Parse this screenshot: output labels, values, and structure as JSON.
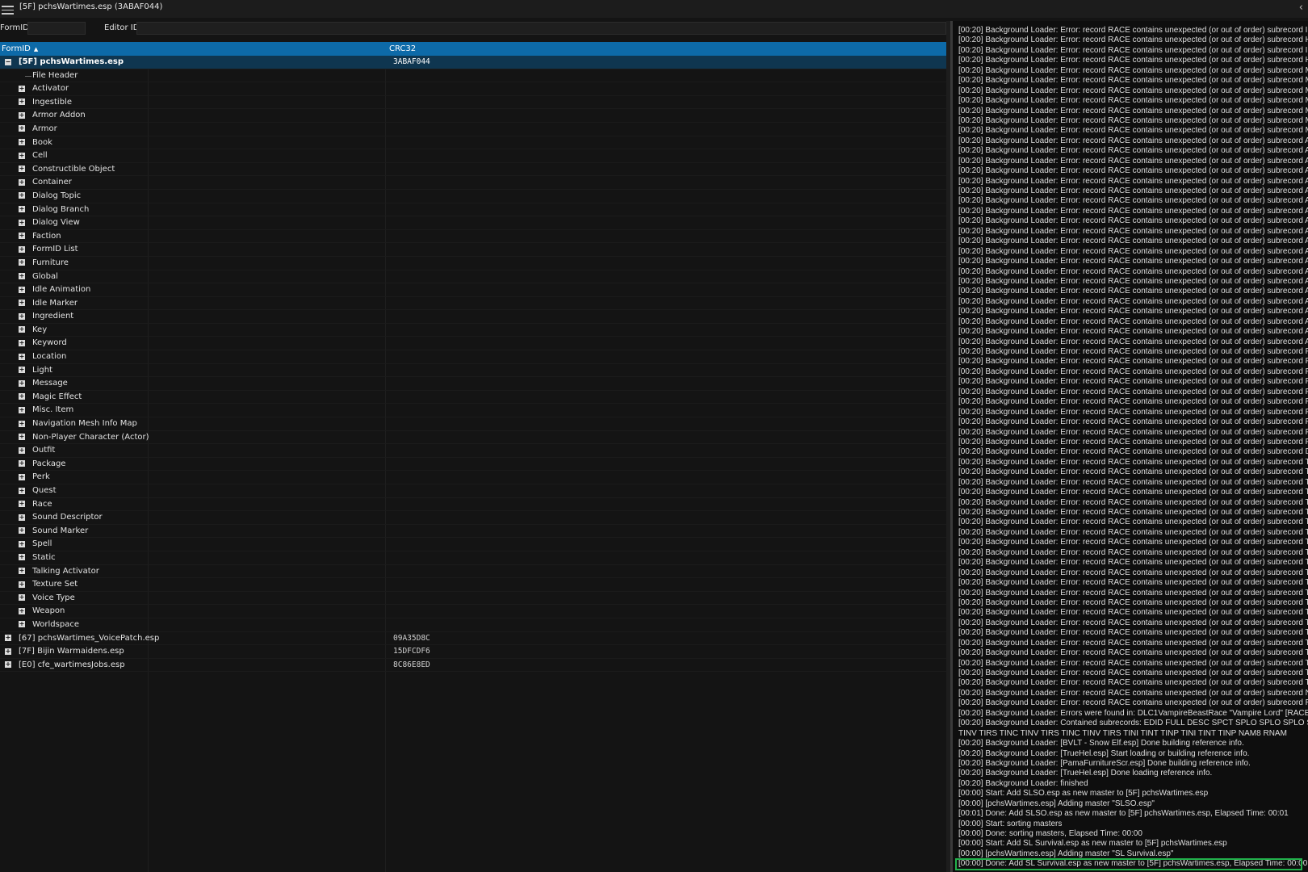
{
  "window": {
    "title": "[5F] pchsWartimes.esp (3ABAF044)"
  },
  "filters": {
    "formid_label": "FormID",
    "editorid_label": "Editor ID",
    "formid_value": "",
    "editorid_value": ""
  },
  "tree": {
    "headers": {
      "formid": "FormID",
      "crc": "CRC32"
    },
    "selected_plugin": {
      "name": "[5F] pchsWartimes.esp",
      "crc": "3ABAF044",
      "expander": "−"
    },
    "file_header": "File Header",
    "groups": [
      "Activator",
      "Ingestible",
      "Armor Addon",
      "Armor",
      "Book",
      "Cell",
      "Constructible Object",
      "Container",
      "Dialog Topic",
      "Dialog Branch",
      "Dialog View",
      "Faction",
      "FormID List",
      "Furniture",
      "Global",
      "Idle Animation",
      "Idle Marker",
      "Ingredient",
      "Key",
      "Keyword",
      "Location",
      "Light",
      "Message",
      "Magic Effect",
      "Misc. Item",
      "Navigation Mesh Info Map",
      "Non-Player Character (Actor)",
      "Outfit",
      "Package",
      "Perk",
      "Quest",
      "Race",
      "Sound Descriptor",
      "Sound Marker",
      "Spell",
      "Static",
      "Talking Activator",
      "Texture Set",
      "Voice Type",
      "Weapon",
      "Worldspace"
    ],
    "other_plugins": [
      {
        "name": "[67] pchsWartimes_VoicePatch.esp",
        "crc": "09A35D8C"
      },
      {
        "name": "[7F] Bijin Warmaidens.esp",
        "crc": "15DFCDF6"
      },
      {
        "name": "[E0] cfe_wartimesJobs.esp",
        "crc": "8C86E8ED"
      }
    ],
    "expander_plus": "+"
  },
  "log": {
    "lines": [
      "[00:20] Background Loader: Error: record RACE contains unexpected (or out of order) subrecord IND",
      "[00:20] Background Loader: Error: record RACE contains unexpected (or out of order) subrecord HEA",
      "[00:20] Background Loader: Error: record RACE contains unexpected (or out of order) subrecord IND",
      "[00:20] Background Loader: Error: record RACE contains unexpected (or out of order) subrecord HEA",
      "[00:20] Background Loader: Error: record RACE contains unexpected (or out of order) subrecord MP",
      "[00:20] Background Loader: Error: record RACE contains unexpected (or out of order) subrecord MP",
      "[00:20] Background Loader: Error: record RACE contains unexpected (or out of order) subrecord MP",
      "[00:20] Background Loader: Error: record RACE contains unexpected (or out of order) subrecord MP",
      "[00:20] Background Loader: Error: record RACE contains unexpected (or out of order) subrecord MP",
      "[00:20] Background Loader: Error: record RACE contains unexpected (or out of order) subrecord MP",
      "[00:20] Background Loader: Error: record RACE contains unexpected (or out of order) subrecord MP",
      "[00:20] Background Loader: Error: record RACE contains unexpected (or out of order) subrecord AH",
      "[00:20] Background Loader: Error: record RACE contains unexpected (or out of order) subrecord AH",
      "[00:20] Background Loader: Error: record RACE contains unexpected (or out of order) subrecord AH",
      "[00:20] Background Loader: Error: record RACE contains unexpected (or out of order) subrecord AH",
      "[00:20] Background Loader: Error: record RACE contains unexpected (or out of order) subrecord AH",
      "[00:20] Background Loader: Error: record RACE contains unexpected (or out of order) subrecord AH",
      "[00:20] Background Loader: Error: record RACE contains unexpected (or out of order) subrecord AH",
      "[00:20] Background Loader: Error: record RACE contains unexpected (or out of order) subrecord AH",
      "[00:20] Background Loader: Error: record RACE contains unexpected (or out of order) subrecord AH",
      "[00:20] Background Loader: Error: record RACE contains unexpected (or out of order) subrecord AH",
      "[00:20] Background Loader: Error: record RACE contains unexpected (or out of order) subrecord AH",
      "[00:20] Background Loader: Error: record RACE contains unexpected (or out of order) subrecord AH",
      "[00:20] Background Loader: Error: record RACE contains unexpected (or out of order) subrecord AH",
      "[00:20] Background Loader: Error: record RACE contains unexpected (or out of order) subrecord AH",
      "[00:20] Background Loader: Error: record RACE contains unexpected (or out of order) subrecord AH",
      "[00:20] Background Loader: Error: record RACE contains unexpected (or out of order) subrecord AH",
      "[00:20] Background Loader: Error: record RACE contains unexpected (or out of order) subrecord AH",
      "[00:20] Background Loader: Error: record RACE contains unexpected (or out of order) subrecord AH",
      "[00:20] Background Loader: Error: record RACE contains unexpected (or out of order) subrecord AH",
      "[00:20] Background Loader: Error: record RACE contains unexpected (or out of order) subrecord AH",
      "[00:20] Background Loader: Error: record RACE contains unexpected (or out of order) subrecord AH",
      "[00:20] Background Loader: Error: record RACE contains unexpected (or out of order) subrecord FTS",
      "[00:20] Background Loader: Error: record RACE contains unexpected (or out of order) subrecord FTS",
      "[00:20] Background Loader: Error: record RACE contains unexpected (or out of order) subrecord FTS",
      "[00:20] Background Loader: Error: record RACE contains unexpected (or out of order) subrecord FTS",
      "[00:20] Background Loader: Error: record RACE contains unexpected (or out of order) subrecord FTS",
      "[00:20] Background Loader: Error: record RACE contains unexpected (or out of order) subrecord FTS",
      "[00:20] Background Loader: Error: record RACE contains unexpected (or out of order) subrecord FTS",
      "[00:20] Background Loader: Error: record RACE contains unexpected (or out of order) subrecord FTS",
      "[00:20] Background Loader: Error: record RACE contains unexpected (or out of order) subrecord FTS",
      "[00:20] Background Loader: Error: record RACE contains unexpected (or out of order) subrecord FTS",
      "[00:20] Background Loader: Error: record RACE contains unexpected (or out of order) subrecord DFT",
      "[00:20] Background Loader: Error: record RACE contains unexpected (or out of order) subrecord TIN",
      "[00:20] Background Loader: Error: record RACE contains unexpected (or out of order) subrecord TIN",
      "[00:20] Background Loader: Error: record RACE contains unexpected (or out of order) subrecord TIN",
      "[00:20] Background Loader: Error: record RACE contains unexpected (or out of order) subrecord TIN",
      "[00:20] Background Loader: Error: record RACE contains unexpected (or out of order) subrecord TIN",
      "[00:20] Background Loader: Error: record RACE contains unexpected (or out of order) subrecord TIN",
      "[00:20] Background Loader: Error: record RACE contains unexpected (or out of order) subrecord TIR",
      "[00:20] Background Loader: Error: record RACE contains unexpected (or out of order) subrecord TIN",
      "[00:20] Background Loader: Error: record RACE contains unexpected (or out of order) subrecord TIN",
      "[00:20] Background Loader: Error: record RACE contains unexpected (or out of order) subrecord TIR",
      "[00:20] Background Loader: Error: record RACE contains unexpected (or out of order) subrecord TIN",
      "[00:20] Background Loader: Error: record RACE contains unexpected (or out of order) subrecord TIN",
      "[00:20] Background Loader: Error: record RACE contains unexpected (or out of order) subrecord TIN",
      "[00:20] Background Loader: Error: record RACE contains unexpected (or out of order) subrecord TIR",
      "[00:20] Background Loader: Error: record RACE contains unexpected (or out of order) subrecord TIN",
      "[00:20] Background Loader: Error: record RACE contains unexpected (or out of order) subrecord TIN",
      "[00:20] Background Loader: Error: record RACE contains unexpected (or out of order) subrecord TIR",
      "[00:20] Background Loader: Error: record RACE contains unexpected (or out of order) subrecord TIN",
      "[00:20] Background Loader: Error: record RACE contains unexpected (or out of order) subrecord TIN",
      "[00:20] Background Loader: Error: record RACE contains unexpected (or out of order) subrecord TIN",
      "[00:20] Background Loader: Error: record RACE contains unexpected (or out of order) subrecord TIN",
      "[00:20] Background Loader: Error: record RACE contains unexpected (or out of order) subrecord TIN",
      "[00:20] Background Loader: Error: record RACE contains unexpected (or out of order) subrecord TIN",
      "[00:20] Background Loader: Error: record RACE contains unexpected (or out of order) subrecord NA",
      "[00:20] Background Loader: Error: record RACE contains unexpected (or out of order) subrecord RNA",
      "[00:20] Background Loader: Errors were found in: DLC1VampireBeastRace \"Vampire Lord\" [RACE:020",
      "[00:20] Background Loader: Contained subrecords: EDID FULL DESC SPCT SPLO SPLO SPLO SPLO W",
      "TINV TIRS TINC TINV TIRS TINC TINV TIRS TINI TINT TINP TINI TINT TINP NAM8 RNAM",
      "[00:20] Background Loader: [BVLT - Snow Elf.esp] Done building reference info.",
      "[00:20] Background Loader: [TrueHel.esp] Start loading or building reference info.",
      "[00:20] Background Loader: [PamaFurnitureScr.esp] Done building reference info.",
      "[00:20] Background Loader: [TrueHel.esp] Done loading reference info.",
      "[00:20] Background Loader: finished",
      "[00:00] Start: Add SLSO.esp as new master to [5F] pchsWartimes.esp",
      "[00:00] [pchsWartimes.esp] Adding master \"SLSO.esp\"",
      "[00:01] Done: Add SLSO.esp as new master to [5F] pchsWartimes.esp, Elapsed Time: 00:01",
      "[00:00] Start: sorting masters",
      "[00:00] Done: sorting masters, Elapsed Time: 00:00",
      "[00:00] Start: Add SL Survival.esp as new master to [5F] pchsWartimes.esp",
      "[00:00] [pchsWartimes.esp] Adding master \"SL Survival.esp\"",
      "[00:00] Done: Add SL Survival.esp as new master to [5F] pchsWartimes.esp, Elapsed Time: 00:00"
    ],
    "highlight_color": "#22b14c"
  }
}
